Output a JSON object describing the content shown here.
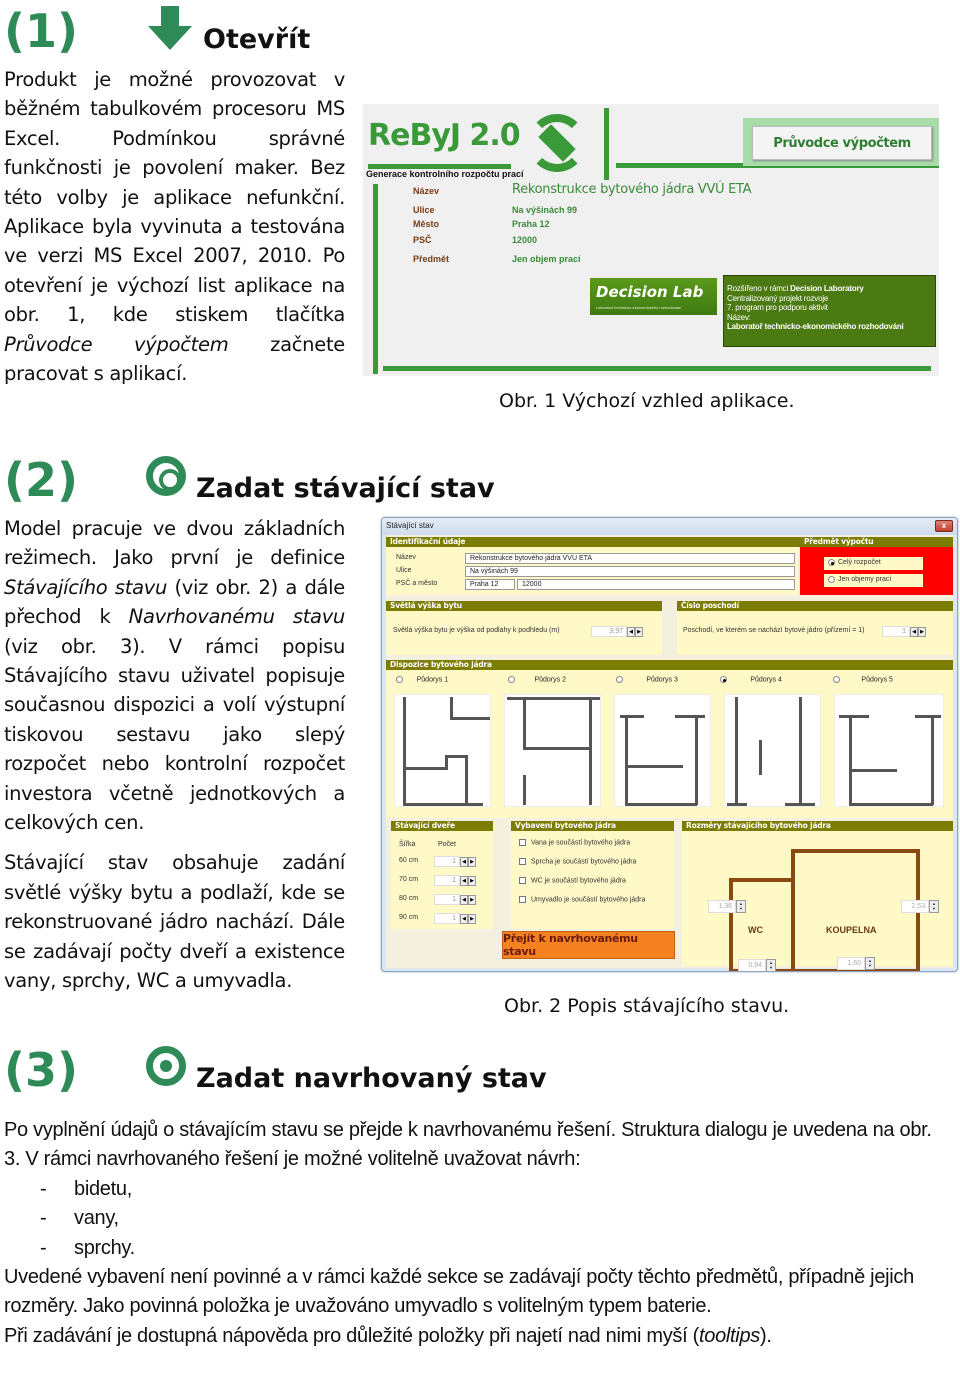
{
  "section1": {
    "number": "(1)",
    "icon": "arrow-down-icon",
    "title": "Otevřít",
    "paragraph": {
      "before_em": "Produkt je možné provozovat v běžném tabulkovém procesoru MS Excel. Podmínkou správné funkčnosti je povolení maker. Bez této volby je aplikace nefunkční. Aplikace byla vyvinuta a testována ve verzi MS Excel 2007, 2010. Po otevření je výchozí list aplikace na obr. 1, kde stiskem tlačítka ",
      "em": "Průvodce výpočtem",
      "after_em": " začnete pracovat s aplikací."
    },
    "figure": {
      "caption": "Obr. 1 Výchozí vzhled aplikace.",
      "app_logo": "ReByJ 2.0",
      "app_subtitle": "Generace kontrolního rozpočtu prací",
      "wizard_button": "Průvodce výpočtem",
      "fields": [
        {
          "label": "Název",
          "value": "Rekonstrukce bytového jádra VVÚ ETA"
        },
        {
          "label": "Ulice",
          "value": "Na výšinách 99"
        },
        {
          "label": "Město",
          "value": "Praha 12"
        },
        {
          "label": "PSČ",
          "value": "12000"
        },
        {
          "label": "Předmět",
          "value": "Jen objem prací"
        }
      ],
      "decision_lab": {
        "title": "Decision Lab",
        "subtitle": "Laboratoř technicko-ekonomického rozhodování"
      },
      "info_box": {
        "line1_prefix": "Rozšířeno v rámci ",
        "line1_bold": "Decision Laboratory",
        "line2": "Centralizovaný projekt rozvoje",
        "line3": "7. program pro podporu aktivit",
        "line4": "Název:",
        "line5": "Laboratoř technicko-ekonomického rozhodování"
      }
    }
  },
  "section2": {
    "number": "(2)",
    "icon": "target-icon",
    "title": "Zadat stávající stav",
    "paragraph1": {
      "p1": "Model pracuje ve dvou základních režimech. Jako první je definice ",
      "em1": "Stávajícího stavu",
      "p2": " (viz obr. 2) a dále přechod k ",
      "em2": "Navrhovanému stavu",
      "p3": " (viz obr. 3). V rámci popisu Stávajícího stavu uživatel popisuje současnou dispozici a volí výstupní tiskovou sestavu jako slepý rozpočet nebo kontrolní rozpočet investora včetně jednotkových a celkových cen."
    },
    "paragraph2": "Stávající stav obsahuje zadání světlé výšky bytu a podlaží, kde se rekonstruované jádro nachází. Dále se zadávají počty dveří a existence vany, sprchy, WC a umyvadla.",
    "figure": {
      "caption": "Obr. 2 Popis stávajícího stavu.",
      "window_title": "Stávající stav",
      "close_label": "x",
      "ident": {
        "header": "Identifikační údaje",
        "labels": [
          "Název",
          "Ulice",
          "PSČ a město"
        ],
        "name": "Rekonstrukce bytového jádra VVÚ ETA",
        "street": "Na výšinách 99",
        "city": "Praha 12",
        "zip": "12000"
      },
      "subject": {
        "header": "Předmět výpočtu",
        "options": [
          {
            "label": "Celý rozpočet",
            "selected": true
          },
          {
            "label": "Jen objemy prací",
            "selected": false
          }
        ]
      },
      "height": {
        "header": "Světlá výška bytu",
        "label": "Světlá výška bytu je výška od podlahy k podhledu (m)",
        "value": "3,97"
      },
      "floor": {
        "header": "Číslo poschodí",
        "label": "Poschodí, ve kterém se nachází bytové jádro (přízemí = 1)",
        "value": "1"
      },
      "layout": {
        "header": "Dispozice bytového jádra",
        "plans": [
          {
            "label": "Půdorys 1",
            "selected": false
          },
          {
            "label": "Půdorys 2",
            "selected": false
          },
          {
            "label": "Půdorys 3",
            "selected": false
          },
          {
            "label": "Půdorys 4",
            "selected": true
          },
          {
            "label": "Půdorys 5",
            "selected": false
          }
        ]
      },
      "doors": {
        "header": "Stávající dveře",
        "col_width": "Šířka",
        "col_count": "Počet",
        "rows": [
          {
            "width": "60 cm",
            "count": "1"
          },
          {
            "width": "70 cm",
            "count": "1"
          },
          {
            "width": "80 cm",
            "count": "1"
          },
          {
            "width": "90 cm",
            "count": "1"
          }
        ]
      },
      "equipment": {
        "header": "Vybavení bytového jádra",
        "items": [
          {
            "label": "Vana je součástí bytového jádra",
            "checked": false
          },
          {
            "label": "Sprcha je součástí bytového jádra",
            "checked": false
          },
          {
            "label": "WC je součástí bytového jádra",
            "checked": false
          },
          {
            "label": "Umyvadlo  je součástí bytového jádra",
            "checked": false
          }
        ]
      },
      "dimensions": {
        "header": "Rozměry stávajícího bytového jádra",
        "wc_label": "WC",
        "bath_label": "KOUPELNA",
        "wc_height": "1,36",
        "wc_width": "0,94",
        "bath_height": "2,53",
        "bath_width": "1,60"
      },
      "go_button": "Přejít k navrhovanému stavu"
    }
  },
  "section3": {
    "number": "(3)",
    "icon": "target-icon",
    "title": "Zadat navrhovaný stav",
    "intro": "Po vyplnění údajů o stávajícím stavu se přejde k navrhovanému řešení. Struktura dialogu je uvedena na obr. 3. V rámci navrhovaného řešení je možné volitelně uvažovat návrh:",
    "list": [
      "bidetu,",
      "vany,",
      "sprchy."
    ],
    "dash": "-",
    "para2": "Uvedené vybavení není povinné a v rámci každé sekce se zadávají počty těchto předmětů, případně jejich rozměry. Jako povinná položka je uvažováno umyvadlo s volitelným typem baterie.",
    "para3_before": "Při zadávání je dostupná nápověda pro důležité položky při najetí nad nimi myší (",
    "para3_em": "tooltips",
    "para3_after": ")."
  }
}
